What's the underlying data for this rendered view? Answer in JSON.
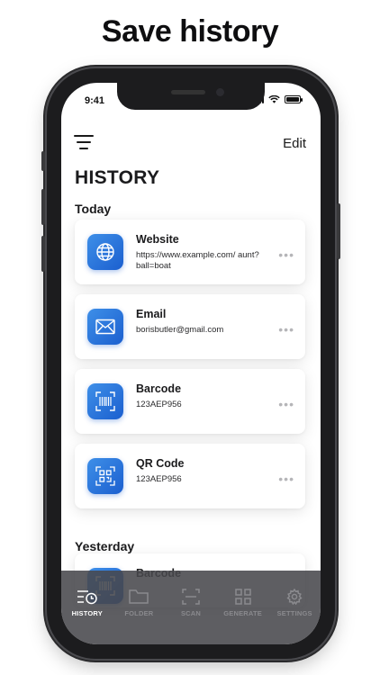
{
  "headline": "Save history",
  "status_bar": {
    "time": "9:41"
  },
  "header": {
    "edit_label": "Edit",
    "title": "HISTORY"
  },
  "sections": [
    {
      "label": "Today",
      "items": [
        {
          "type": "Website",
          "icon": "globe-icon",
          "detail": "https://www.example.com/ aunt?ball=boat"
        },
        {
          "type": "Email",
          "icon": "envelope-icon",
          "detail": "borisbutler@gmail.com"
        },
        {
          "type": "Barcode",
          "icon": "barcode-icon",
          "detail": "123AEP956"
        },
        {
          "type": "QR Code",
          "icon": "qr-code-icon",
          "detail": "123AEP956"
        }
      ]
    },
    {
      "label": "Yesterday",
      "items": [
        {
          "type": "Barcode",
          "icon": "barcode-icon",
          "detail": ""
        }
      ]
    }
  ],
  "more_glyph": "•••",
  "tabbar": [
    {
      "label": "HISTORY",
      "icon": "history-icon",
      "active": true
    },
    {
      "label": "FOLDER",
      "icon": "folder-icon",
      "active": false
    },
    {
      "label": "SCAN",
      "icon": "scan-icon",
      "active": false
    },
    {
      "label": "GENERATE",
      "icon": "grid-icon",
      "active": false
    },
    {
      "label": "SETTINGS",
      "icon": "gear-icon",
      "active": false
    }
  ],
  "colors": {
    "accent_blue": "#1b5fcf",
    "tab_bar": "#48484c",
    "text_dark": "#1b1b1d"
  }
}
